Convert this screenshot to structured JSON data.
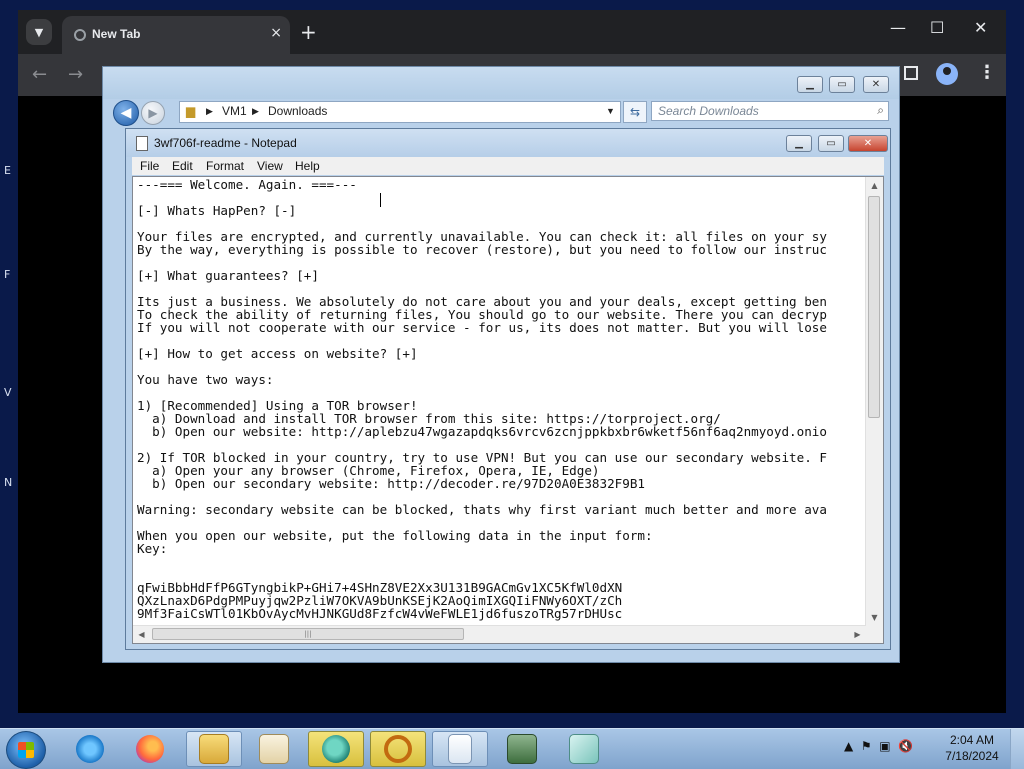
{
  "chrome": {
    "tab_title": "New Tab",
    "tab_close": "×",
    "new_tab": "+",
    "minimize": "—",
    "maximize": "☐",
    "close": "✕",
    "back": "←",
    "forward": "→",
    "menu": "⋮"
  },
  "explorer": {
    "address_segments": [
      "VM1",
      "Downloads"
    ],
    "search_placeholder": "Search Downloads"
  },
  "notepad": {
    "title": "3wf706f-readme - Notepad",
    "menu": [
      "File",
      "Edit",
      "Format",
      "View",
      "Help"
    ],
    "content": "---=== Welcome. Again. ===---\n\n[-] Whats HapPen? [-]\n\nYour files are encrypted, and currently unavailable. You can check it: all files on your sy\nBy the way, everything is possible to recover (restore), but you need to follow our instruc\n\n[+] What guarantees? [+]\n\nIts just a business. We absolutely do not care about you and your deals, except getting ben\nTo check the ability of returning files, You should go to our website. There you can decryp\nIf you will not cooperate with our service - for us, its does not matter. But you will lose\n\n[+] How to get access on website? [+]\n\nYou have two ways:\n\n1) [Recommended] Using a TOR browser!\n  a) Download and install TOR browser from this site: https://torproject.org/\n  b) Open our website: http://aplebzu47wgazapdqks6vrcv6zcnjppkbxbr6wketf56nf6aq2nmyoyd.onio\n\n2) If TOR blocked in your country, try to use VPN! But you can use our secondary website. F\n  a) Open your any browser (Chrome, Firefox, Opera, IE, Edge)\n  b) Open our secondary website: http://decoder.re/97D20A0E3832F9B1\n\nWarning: secondary website can be blocked, thats why first variant much better and more ava\n\nWhen you open our website, put the following data in the input form:\nKey:\n\n\nqFwiBbbHdFfP6GTyngbikP+GHi7+4SHnZ8VE2Xx3U131B9GACmGv1XC5KfWl0dXN\nQXzLnaxD6PdgPMPuyjqw2PzliW7OKVA9bUnKSEjK2AoQimIXGQIiFNWy6OXT/zCh\n9Mf3FaiCsWTl01KbOvAycMvHJNKGUd8FzfcW4vWeFWLE1jd6fuszoTRg57rDHUsc"
  },
  "taskbar": {
    "time": "2:04 AM",
    "date": "7/18/2024"
  },
  "desktop_letters": [
    "E",
    "F",
    "V",
    "N"
  ]
}
